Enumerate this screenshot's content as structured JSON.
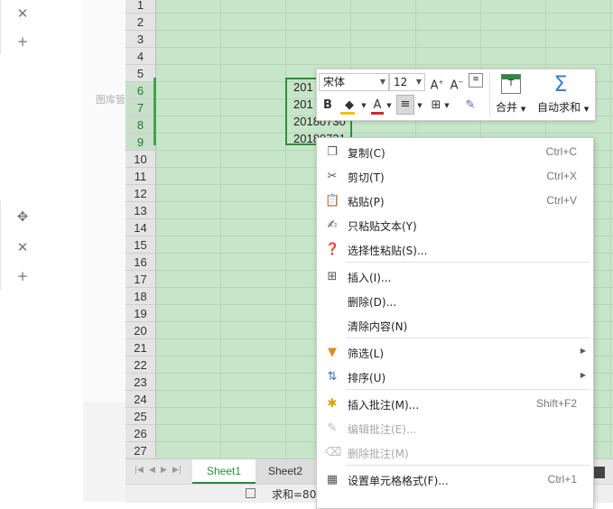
{
  "left_panel": {
    "icons": [
      "close-icon",
      "add-icon",
      "move-icon",
      "close-icon",
      "add-icon"
    ],
    "library_label": "图库管"
  },
  "grid": {
    "row_numbers": [
      "1",
      "2",
      "3",
      "4",
      "5",
      "6",
      "7",
      "8",
      "9",
      "10",
      "11",
      "12",
      "13",
      "14",
      "15",
      "16",
      "17",
      "18",
      "19",
      "20",
      "21",
      "22",
      "23",
      "24",
      "25",
      "26",
      "27"
    ],
    "selected_rows": [
      "6",
      "7",
      "8",
      "9"
    ],
    "cells": [
      "201",
      "201",
      "20180730",
      "20180731"
    ]
  },
  "mini_toolbar": {
    "font_name": "宋体",
    "font_size": "12",
    "bold": "B",
    "merge_label": "合并",
    "autosum_label": "自动求和",
    "fill_color": "#f2c200",
    "font_color": "#d22b2b"
  },
  "context_menu": {
    "items": [
      {
        "icon": "copy-icon",
        "label": "复制(C)",
        "shortcut": "Ctrl+C",
        "disabled": false
      },
      {
        "icon": "scissors-icon",
        "label": "剪切(T)",
        "shortcut": "Ctrl+X",
        "disabled": false
      },
      {
        "icon": "paste-icon",
        "label": "粘贴(P)",
        "shortcut": "Ctrl+V",
        "disabled": false
      },
      {
        "icon": "paste-text-icon",
        "label": "只粘贴文本(Y)",
        "shortcut": "",
        "disabled": false
      },
      {
        "icon": "paste-special-icon",
        "label": "选择性粘贴(S)...",
        "shortcut": "",
        "disabled": false
      },
      {
        "icon": "insert-icon",
        "label": "插入(I)...",
        "shortcut": "",
        "disabled": false
      },
      {
        "icon": "",
        "label": "删除(D)...",
        "shortcut": "",
        "disabled": false
      },
      {
        "icon": "",
        "label": "清除内容(N)",
        "shortcut": "",
        "disabled": false
      },
      {
        "icon": "filter-icon",
        "label": "筛选(L)",
        "shortcut": "",
        "disabled": false,
        "submenu": true
      },
      {
        "icon": "sort-icon",
        "label": "排序(U)",
        "shortcut": "",
        "disabled": false,
        "submenu": true
      },
      {
        "icon": "insert-comment-icon",
        "label": "插入批注(M)...",
        "shortcut": "Shift+F2",
        "disabled": false
      },
      {
        "icon": "edit-comment-icon",
        "label": "编辑批注(E)...",
        "shortcut": "",
        "disabled": true
      },
      {
        "icon": "delete-comment-icon",
        "label": "删除批注(M)",
        "shortcut": "",
        "disabled": true
      },
      {
        "icon": "format-cells-icon",
        "label": "设置单元格格式(F)...",
        "shortcut": "Ctrl+1",
        "disabled": false
      }
    ]
  },
  "tabs": [
    "Sheet1",
    "Sheet2"
  ],
  "status": {
    "sum_text": "求和=80"
  }
}
